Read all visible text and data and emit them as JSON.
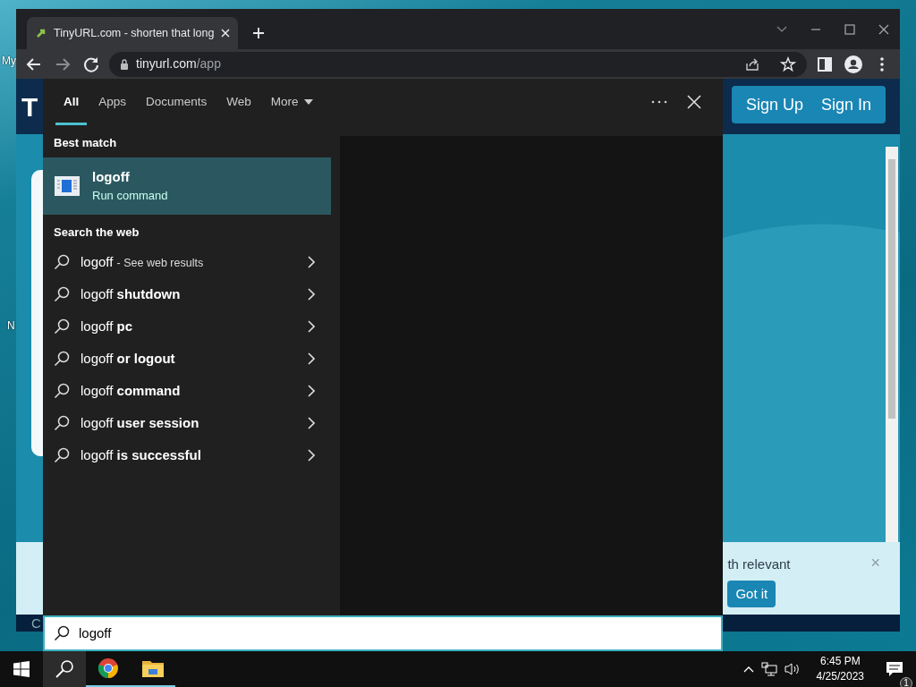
{
  "desktop_icons": [
    {
      "label": "My"
    },
    {
      "label": "N"
    }
  ],
  "browser": {
    "tab": {
      "title": "TinyURL.com - shorten that long",
      "selected": true
    },
    "address": {
      "host": "tinyurl.com",
      "path": "/app"
    },
    "page": {
      "logo_fragment": "T",
      "header_buttons": [
        "Sign Up",
        "Sign In"
      ],
      "cookie_banner": {
        "text": "th relevant",
        "button": "Got it",
        "close": "×"
      },
      "footer_fragment": "C"
    }
  },
  "search": {
    "tabs": [
      {
        "label": "All",
        "selected": true,
        "dropdown": false
      },
      {
        "label": "Apps",
        "selected": false,
        "dropdown": false
      },
      {
        "label": "Documents",
        "selected": false,
        "dropdown": false
      },
      {
        "label": "Web",
        "selected": false,
        "dropdown": false
      },
      {
        "label": "More",
        "selected": false,
        "dropdown": true
      }
    ],
    "best_match_heading": "Best match",
    "best_match": {
      "title": "logoff",
      "subtitle": "Run command",
      "selected": true
    },
    "web_heading": "Search the web",
    "web_results": [
      {
        "kind": "see_results",
        "query": "logoff",
        "completion": "- See web results"
      },
      {
        "kind": "suggestion",
        "query": "logoff",
        "completion": "shutdown"
      },
      {
        "kind": "suggestion",
        "query": "logoff",
        "completion": "pc"
      },
      {
        "kind": "suggestion",
        "query": "logoff",
        "completion": "or logout"
      },
      {
        "kind": "suggestion",
        "query": "logoff",
        "completion": "command"
      },
      {
        "kind": "suggestion",
        "query": "logoff",
        "completion": "user session"
      },
      {
        "kind": "suggestion",
        "query": "logoff",
        "completion": "is successful"
      }
    ],
    "query": "logoff"
  },
  "taskbar": {
    "buttons": [
      {
        "kind": "start",
        "selected": false,
        "running": false
      },
      {
        "kind": "search",
        "selected": true,
        "running": false
      },
      {
        "kind": "chrome",
        "selected": false,
        "running": true
      },
      {
        "kind": "explorer",
        "selected": false,
        "running": true
      }
    ],
    "time": "6:45 PM",
    "date": "4/25/2023",
    "notification_count": "1"
  }
}
